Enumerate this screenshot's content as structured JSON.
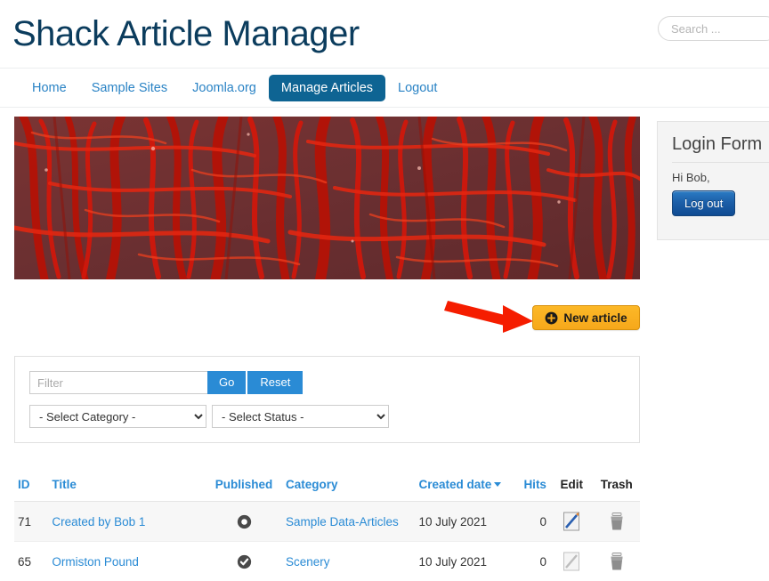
{
  "header": {
    "site_title": "Shack Article Manager",
    "search_placeholder": "Search ...",
    "search_value": ""
  },
  "nav": {
    "items": [
      {
        "label": "Home",
        "active": false
      },
      {
        "label": "Sample Sites",
        "active": false
      },
      {
        "label": "Joomla.org",
        "active": false
      },
      {
        "label": "Manage Articles",
        "active": true
      },
      {
        "label": "Logout",
        "active": false
      }
    ]
  },
  "banner": {
    "alt": "Red Japanese maple foliage banner image"
  },
  "login_module": {
    "title": "Login Form",
    "greeting": "Hi Bob,",
    "logout_label": "Log out"
  },
  "actions": {
    "new_article_label": "New article",
    "new_article_icon": "plus-circle-icon"
  },
  "filters": {
    "filter_placeholder": "Filter",
    "filter_value": "",
    "go_label": "Go",
    "reset_label": "Reset",
    "category_selected": "- Select Category -",
    "status_selected": "- Select Status -"
  },
  "table": {
    "columns": [
      {
        "key": "id",
        "label": "ID",
        "link": true,
        "sorted": false
      },
      {
        "key": "title",
        "label": "Title",
        "link": true,
        "sorted": false
      },
      {
        "key": "published",
        "label": "Published",
        "link": true,
        "sorted": false
      },
      {
        "key": "category",
        "label": "Category",
        "link": true,
        "sorted": false
      },
      {
        "key": "created",
        "label": "Created date",
        "link": true,
        "sorted": true
      },
      {
        "key": "hits",
        "label": "Hits",
        "link": true,
        "sorted": false
      },
      {
        "key": "edit",
        "label": "Edit",
        "link": false,
        "sorted": false
      },
      {
        "key": "trash",
        "label": "Trash",
        "link": false,
        "sorted": false
      }
    ],
    "rows": [
      {
        "id": "71",
        "title": "Created by Bob 1",
        "published_state": "unpublished",
        "category": "Sample Data-Articles",
        "created": "10 July 2021",
        "hits": "0",
        "edit_enabled": true,
        "trash_enabled": true
      },
      {
        "id": "65",
        "title": "Ormiston Pound",
        "published_state": "published",
        "category": "Scenery",
        "created": "10 July 2021",
        "hits": "0",
        "edit_enabled": false,
        "trash_enabled": true
      }
    ]
  },
  "annotation": {
    "type": "arrow",
    "color": "#f51d00",
    "points_to": "new-article-button"
  },
  "colors": {
    "link_blue": "#2a8bd5",
    "nav_active_blue": "#0e6493",
    "title_navy": "#0b3c5d",
    "new_article_orange": "#f6a81b",
    "arrow_red": "#f51d00",
    "row_stripe": "#f7f7f7"
  }
}
